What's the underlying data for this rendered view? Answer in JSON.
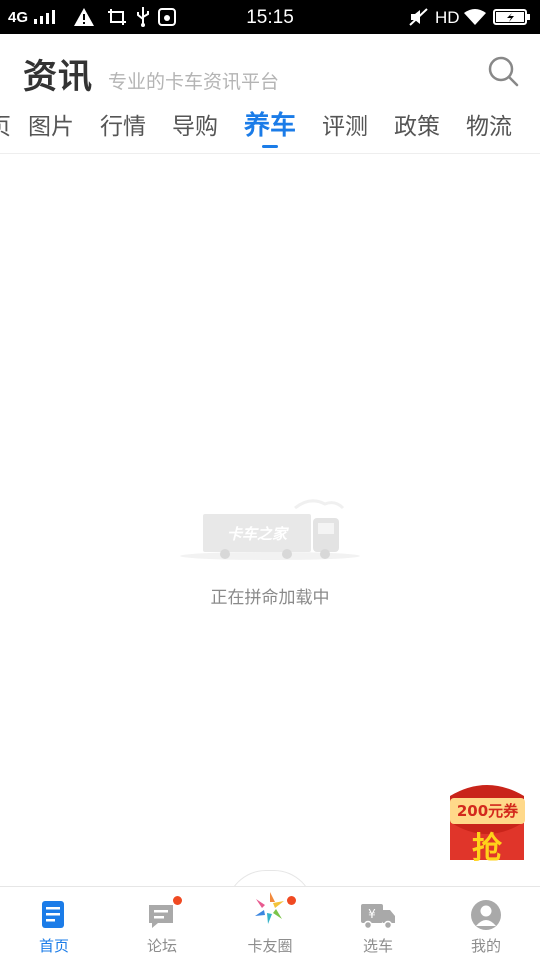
{
  "status_bar": {
    "network": "4G",
    "time": "15:15",
    "hd": "HD"
  },
  "header": {
    "title": "资讯",
    "subtitle": "专业的卡车资讯平台",
    "search_icon": "search-icon"
  },
  "tabs": {
    "items": [
      {
        "label": "页"
      },
      {
        "label": "图片"
      },
      {
        "label": "行情"
      },
      {
        "label": "导购"
      },
      {
        "label": "养车"
      },
      {
        "label": "评测"
      },
      {
        "label": "政策"
      },
      {
        "label": "物流"
      }
    ],
    "active": "养车"
  },
  "loading": {
    "logo_text": "卡车之家",
    "text": "正在拼命加载中"
  },
  "coupon": {
    "amount": "200元券",
    "action": "抢"
  },
  "bottom_nav": {
    "items": [
      {
        "label": "首页",
        "icon": "home-icon"
      },
      {
        "label": "论坛",
        "icon": "forum-icon"
      },
      {
        "label": "卡友圈",
        "icon": "moments-icon"
      },
      {
        "label": "选车",
        "icon": "truck-select-icon"
      },
      {
        "label": "我的",
        "icon": "profile-icon"
      }
    ],
    "active": "首页"
  },
  "colors": {
    "accent": "#1b7ce8",
    "badge": "#f04a22",
    "coupon_red": "#d3281c"
  }
}
